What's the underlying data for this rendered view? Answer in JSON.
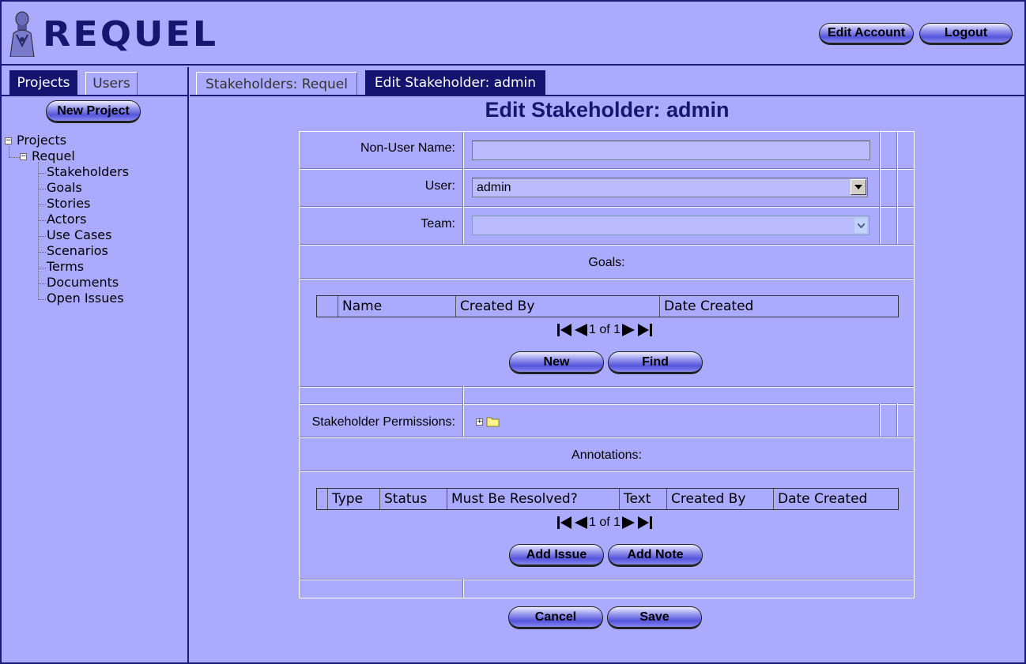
{
  "app": {
    "logo_text": "REQUEL"
  },
  "header": {
    "edit_account_label": "Edit Account",
    "logout_label": "Logout"
  },
  "sidebar": {
    "tabs": [
      {
        "label": "Projects",
        "active": true
      },
      {
        "label": "Users",
        "active": false
      }
    ],
    "new_project_label": "New Project",
    "tree": {
      "root": "Projects",
      "project": "Requel",
      "items": [
        "Stakeholders",
        "Goals",
        "Stories",
        "Actors",
        "Use Cases",
        "Scenarios",
        "Terms",
        "Documents",
        "Open Issues"
      ]
    }
  },
  "main": {
    "tabs": [
      {
        "label": "Stakeholders: Requel",
        "active": false
      },
      {
        "label": "Edit Stakeholder: admin",
        "active": true
      }
    ],
    "title": "Edit Stakeholder: admin",
    "form": {
      "non_user_name_label": "Non-User Name:",
      "non_user_name_value": "",
      "user_label": "User:",
      "user_value": "admin",
      "team_label": "Team:",
      "team_value": "",
      "goals_label": "Goals:",
      "goals_columns": [
        "Name",
        "Created By",
        "Date Created"
      ],
      "goals_pager": "1 of 1",
      "goals_new_label": "New",
      "goals_find_label": "Find",
      "permissions_label": "Stakeholder Permissions:",
      "annotations_label": "Annotations:",
      "annotations_columns": [
        "Type",
        "Status",
        "Must Be Resolved?",
        "Text",
        "Created By",
        "Date Created"
      ],
      "annotations_pager": "1 of 1",
      "add_issue_label": "Add Issue",
      "add_note_label": "Add Note",
      "cancel_label": "Cancel",
      "save_label": "Save"
    }
  },
  "colors": {
    "background": "#aaaaff",
    "accent_dark": "#141470",
    "title": "#16166e"
  },
  "icons": [
    "logo-figure-icon",
    "minus-icon",
    "plus-icon",
    "folder-icon",
    "first-page-icon",
    "prev-page-icon",
    "next-page-icon",
    "last-page-icon",
    "dropdown-arrow-icon"
  ]
}
